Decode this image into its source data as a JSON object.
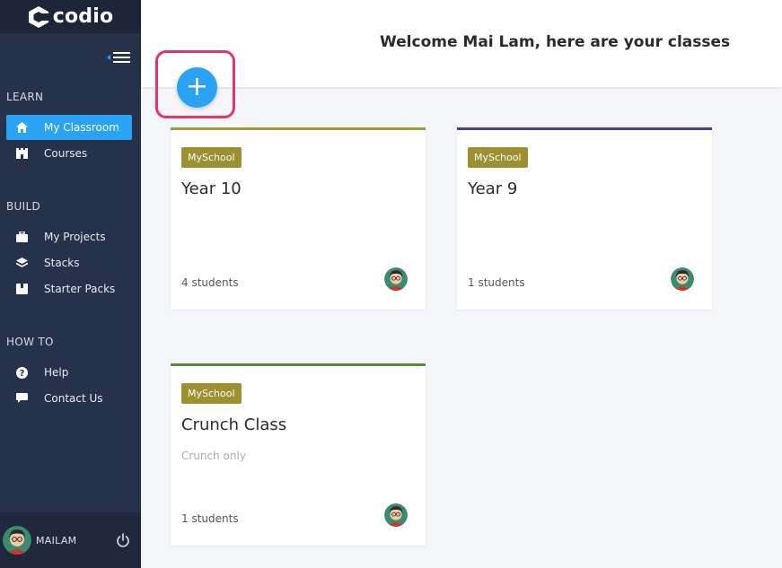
{
  "app": {
    "logo_text": "codio"
  },
  "sidebar": {
    "sections": [
      {
        "title": "LEARN",
        "items": [
          {
            "label": "My Classroom",
            "icon": "home-icon",
            "active": true
          },
          {
            "label": "Courses",
            "icon": "castle-icon"
          }
        ]
      },
      {
        "title": "BUILD",
        "items": [
          {
            "label": "My Projects",
            "icon": "briefcase-icon"
          },
          {
            "label": "Stacks",
            "icon": "layers-icon"
          },
          {
            "label": "Starter Packs",
            "icon": "package-icon"
          }
        ]
      },
      {
        "title": "HOW TO",
        "items": [
          {
            "label": "Help",
            "icon": "question-icon"
          },
          {
            "label": "Contact Us",
            "icon": "chat-bubble-icon"
          }
        ]
      }
    ],
    "user": {
      "name": "MAILAM"
    }
  },
  "header": {
    "welcome": "Welcome Mai Lam, here are your classes",
    "add_label": "+"
  },
  "colors": {
    "accent": "#2aa3f5",
    "sidebar": "#26314a",
    "badge": "#9c9030",
    "highlight": "#e8336d"
  },
  "classes": [
    {
      "school": "MySchool",
      "title": "Year 10",
      "subtitle": "",
      "students": "4 students",
      "bar_color": "#9c9a3a"
    },
    {
      "school": "MySchool",
      "title": "Year 9",
      "subtitle": "",
      "students": "1 students",
      "bar_color": "#4c3e8a"
    },
    {
      "school": "MySchool",
      "title": "Crunch Class",
      "subtitle": "Crunch only",
      "students": "1 students",
      "bar_color": "#5a8a3c"
    }
  ]
}
